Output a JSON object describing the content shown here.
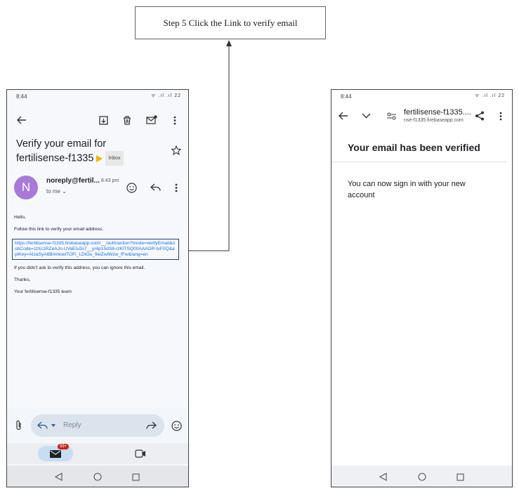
{
  "callout": {
    "text": "Step 5 Click the Link to verify email"
  },
  "left_phone": {
    "status_time": "8:44",
    "status_icons": "ᯤ .ıl .ıl 22",
    "subject_line1": "Verify your email for",
    "subject_line2": "fertilisense-f1335",
    "label": "Inbox",
    "avatar_letter": "N",
    "sender": "noreply@fertil...",
    "sent_time": "8:43 pm",
    "to_me": "to me",
    "body": {
      "greeting": "Hello,",
      "instruction": "Follow this link to verify your email address.",
      "link": "https://fertilisense-f1335.firebaseapp.com/__/auth/action?mode=verifyEmail&oobCode=1tXc1RZeAJn-UVaEIu3s7__yr4p15dS8-rzKlTSQ00AAAGR-txF0Q&apiKey=AIzaSyA6BmnioelTOFi_LDtOu_9elZwlWzw_fFw&lang=en",
      "ignore": "If you didn't ask to verify this address, you can ignore this email.",
      "thanks": "Thanks,",
      "team": "Your fertilisense-f1335 team"
    },
    "reply_label": "Reply",
    "mail_badge": "99+"
  },
  "right_phone": {
    "status_time": "8:44",
    "status_icons": "ᯤ .ıl .ıl 22",
    "url_title": "fertilisense-f1335....",
    "url_sub": "nse-f1335.firebaseapp.com",
    "heading": "Your email has been verified",
    "message": "You can now sign in with your new account"
  },
  "colors": {
    "avatar": "#a879d6",
    "link": "#1a73e8",
    "highlight_box": "#24476b",
    "badge": "#c5221f"
  }
}
